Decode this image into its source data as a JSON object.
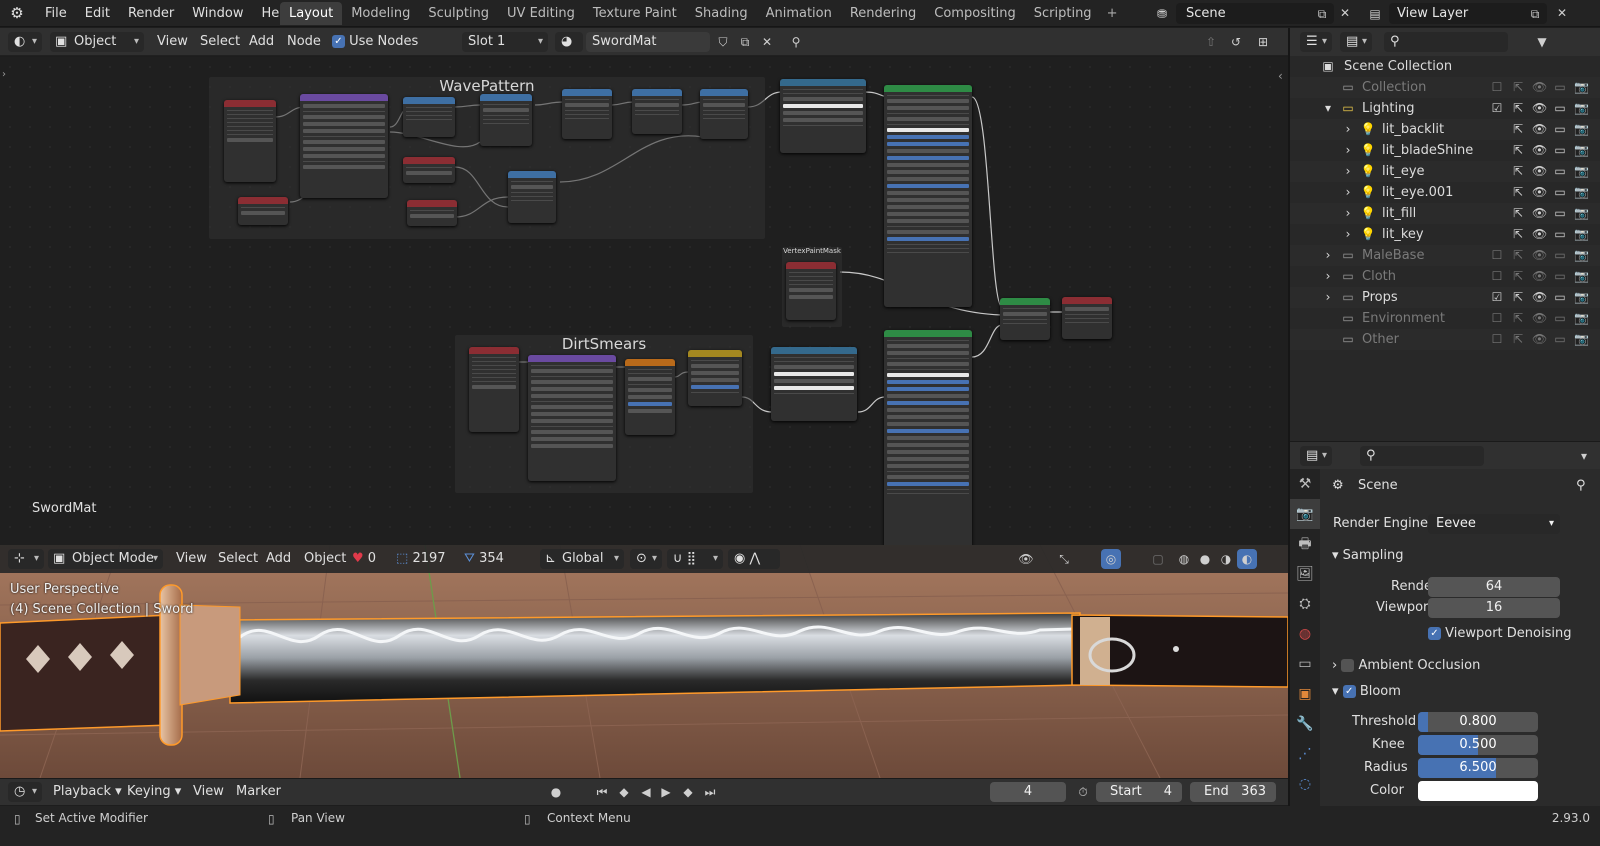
{
  "topbar": {
    "menu": [
      "File",
      "Edit",
      "Render",
      "Window",
      "Help"
    ],
    "workspaces": [
      "Layout",
      "Modeling",
      "Sculpting",
      "UV Editing",
      "Texture Paint",
      "Shading",
      "Animation",
      "Rendering",
      "Compositing",
      "Scripting"
    ],
    "active_workspace": "Layout",
    "scene": "Scene",
    "view_layer": "View Layer"
  },
  "node_header": {
    "editor_mode": "Object",
    "menus": [
      "View",
      "Select",
      "Add",
      "Node"
    ],
    "use_nodes_label": "Use Nodes",
    "slot": "Slot 1",
    "material": "SwordMat"
  },
  "node_editor": {
    "frames": [
      "WavePattern",
      "VertexPaintMask",
      "DirtSmears"
    ],
    "material_label": "SwordMat"
  },
  "viewport": {
    "mode": "Object Mode",
    "menus": [
      "View",
      "Select",
      "Add",
      "Object"
    ],
    "stat_a": "0",
    "stat_b": "2197",
    "stat_c": "354",
    "transform": "Global",
    "info_line1": "User Perspective",
    "info_line2": "(4) Scene Collection | Sword"
  },
  "timeline": {
    "menus": [
      "Playback",
      "Keying",
      "View",
      "Marker"
    ],
    "current_frame": "4",
    "start_label": "Start",
    "start": "4",
    "end_label": "End",
    "end": "363"
  },
  "statusbar": {
    "item1": "Set Active Modifier",
    "item2": "Pan View",
    "item3": "Context Menu",
    "version": "2.93.0"
  },
  "outliner": {
    "root": "Scene Collection",
    "items": [
      {
        "label": "Collection",
        "dim": true
      },
      {
        "label": "Lighting",
        "dim": false
      },
      {
        "label": "lit_backlit",
        "dim": false
      },
      {
        "label": "lit_bladeShine",
        "dim": false
      },
      {
        "label": "lit_eye",
        "dim": false
      },
      {
        "label": "lit_eye.001",
        "dim": false
      },
      {
        "label": "lit_fill",
        "dim": false
      },
      {
        "label": "lit_key",
        "dim": false
      },
      {
        "label": "MaleBase",
        "dim": true
      },
      {
        "label": "Cloth",
        "dim": true
      },
      {
        "label": "Props",
        "dim": false
      },
      {
        "label": "Environment",
        "dim": true
      },
      {
        "label": "Other",
        "dim": true
      }
    ]
  },
  "properties": {
    "context": "Scene",
    "render_engine_label": "Render Engine",
    "render_engine": "Eevee",
    "sampling": "Sampling",
    "render_label": "Render",
    "render_samples": "64",
    "viewport_label": "Viewport",
    "viewport_samples": "16",
    "viewport_denoising": "Viewport Denoising",
    "ambient_occlusion": "Ambient Occlusion",
    "bloom": "Bloom",
    "threshold_label": "Threshold",
    "threshold": "0.800",
    "threshold_fraction": 0.08,
    "knee_label": "Knee",
    "knee": "0.500",
    "knee_fraction": 0.5,
    "radius_label": "Radius",
    "radius": "6.500",
    "radius_fraction": 0.65,
    "color_label": "Color"
  }
}
